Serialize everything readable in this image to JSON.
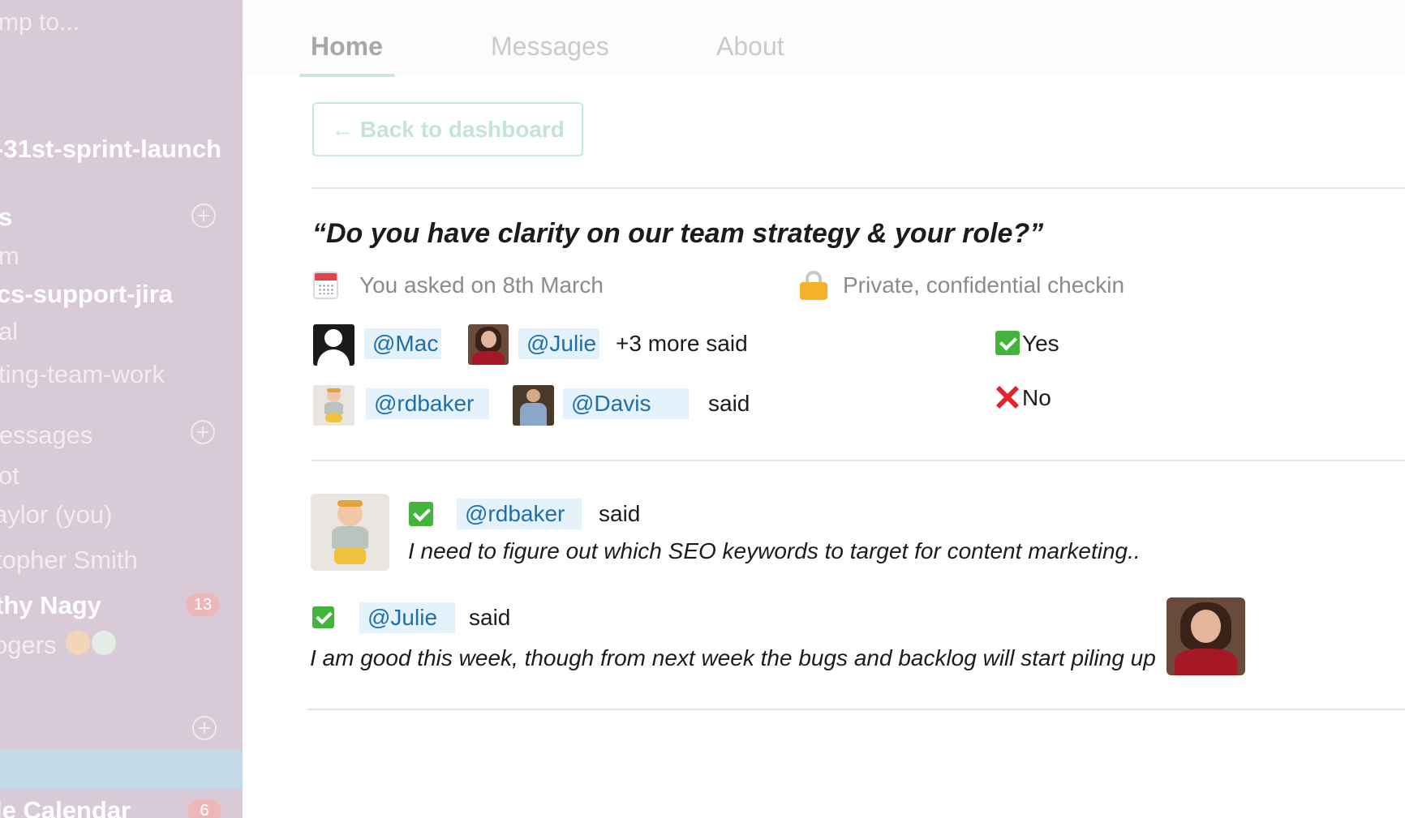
{
  "sidebar": {
    "jump_placeholder": "mp to...",
    "channel_sprint": "-31st-sprint-launch",
    "section_channels": "s",
    "channel_m": "m",
    "channel_cs_support": "cs-support-jira",
    "channel_al": "al",
    "channel_ting": "ting-team-work",
    "section_messages": "lessages",
    "dm_bot": "ot",
    "dm_self": "aylor (you)",
    "dm_topher": "topher Smith",
    "dm_nagy": "thy Nagy",
    "dm_nagy_badge": "13",
    "dm_rogers": "ogers",
    "app_calendar": "le Calendar",
    "app_calendar_badge": "6"
  },
  "tabs": {
    "home": "Home",
    "messages": "Messages",
    "about": "About"
  },
  "back_button": "← Back to dashboard",
  "checkin": {
    "question": "“Do you have clarity on our team strategy & your role?”",
    "asked_on": "You asked on 8th March",
    "privacy": "Private, confidential checkin"
  },
  "summary": {
    "yes_row": {
      "mention_1": "@Mac",
      "mention_2": "@Julie",
      "trailing": "+3 more said",
      "answer": "Yes"
    },
    "no_row": {
      "mention_1": "@rdbaker",
      "mention_2": "@Davis",
      "trailing": "said",
      "answer": "No"
    }
  },
  "responses": [
    {
      "mention": "@rdbaker",
      "said": "said",
      "text": "I need to figure out which SEO keywords to target for content marketing.."
    },
    {
      "mention": "@Julie",
      "said": "said",
      "text": "I am good this week, though from next week the bugs and backlog will start piling up"
    }
  ],
  "colors": {
    "sidebar_bg": "#d8cad6",
    "mention_bg": "#e4f2fb",
    "mention_text": "#1f6fa8",
    "yes_green": "#44b53c",
    "no_red": "#e3232a"
  }
}
